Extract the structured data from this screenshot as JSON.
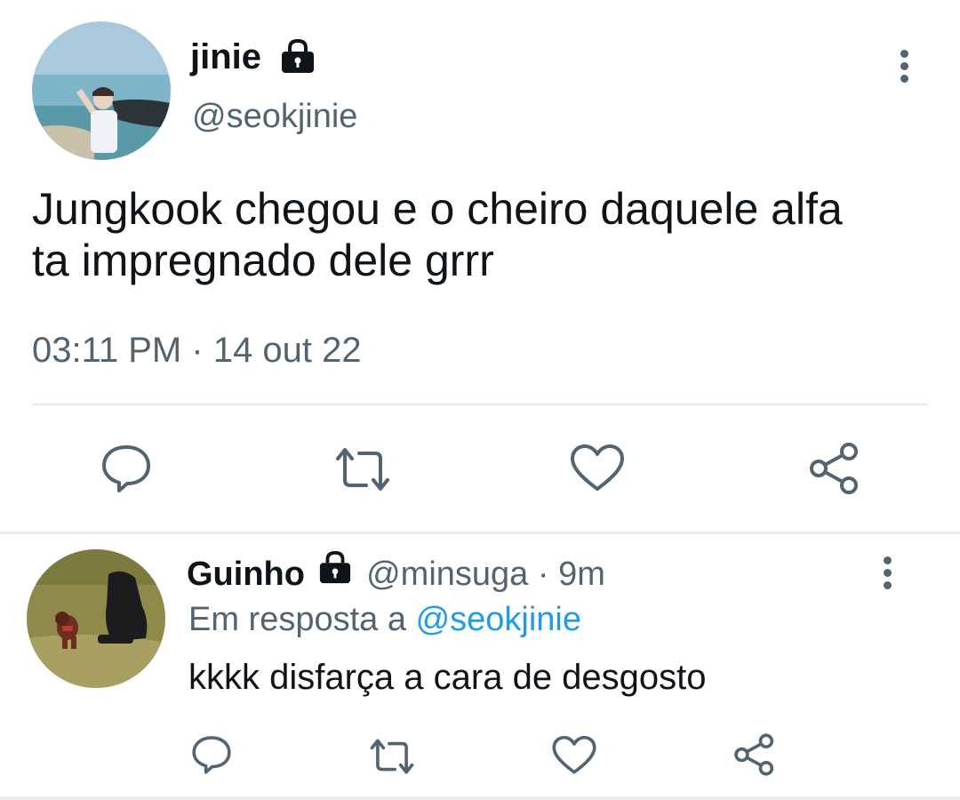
{
  "tweet": {
    "author_name": "jinie",
    "author_handle": "@seokjinie",
    "text_line1": "Jungkook chegou e o cheiro daquele alfa",
    "text_line2": "ta impregnado dele grrr",
    "time": "03:11 PM",
    "separator": "·",
    "date": "14 out 22",
    "icons": [
      "lock-icon",
      "more-icon",
      "reply-icon",
      "retweet-icon",
      "like-icon",
      "share-icon"
    ]
  },
  "reply": {
    "author_name": "Guinho",
    "author_handle": "@minsuga",
    "separator": "·",
    "age": "9m",
    "in_reply_to_prefix": "Em resposta a",
    "in_reply_to_handle": "@seokjinie",
    "text": "kkkk disfarça a cara de desgosto"
  },
  "colors": {
    "text": "#0f1419",
    "secondary": "#536471",
    "link": "#1d9bf0",
    "divider": "#e7e9eb"
  }
}
